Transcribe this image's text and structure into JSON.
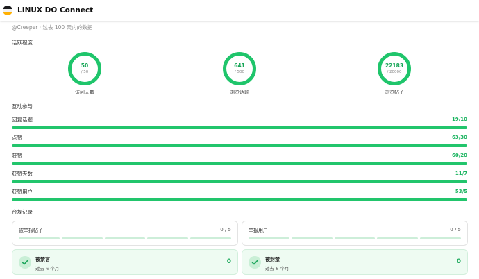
{
  "app": {
    "title": "LINUX DO Connect"
  },
  "subtitle": "@Creeper · 过去 100 天内的数据",
  "activity": {
    "label": "活跃程度",
    "rings": [
      {
        "value": "50",
        "target": "/ 50",
        "label": "访问天数",
        "progress": 1.0
      },
      {
        "value": "641",
        "target": "/ 500",
        "label": "浏览话题",
        "progress": 1.0
      },
      {
        "value": "22183",
        "target": "/ 20000",
        "label": "浏览帖子",
        "progress": 1.0
      }
    ]
  },
  "interaction": {
    "label": "互动参与",
    "rows": [
      {
        "label": "回复话题",
        "value": "19/10",
        "progress": 1.0
      },
      {
        "label": "点赞",
        "value": "63/30",
        "progress": 1.0
      },
      {
        "label": "获赞",
        "value": "60/20",
        "progress": 1.0
      },
      {
        "label": "获赞天数",
        "value": "11/7",
        "progress": 1.0
      },
      {
        "label": "获赞用户",
        "value": "53/5",
        "progress": 1.0
      }
    ]
  },
  "compliance": {
    "label": "合规记录",
    "reports": [
      {
        "title": "被举报帖子",
        "count": "0 / 5",
        "filled": 0,
        "segments": 5
      },
      {
        "title": "举报用户",
        "count": "0 / 5",
        "filled": 0,
        "segments": 5
      }
    ],
    "status": [
      {
        "title": "被禁言",
        "time": "过去 6 个月",
        "count": "0"
      },
      {
        "title": "被封禁",
        "time": "过去 6 个月",
        "count": "0"
      }
    ]
  },
  "colors": {
    "accent": "#22c56c",
    "track": "#d7f3e2",
    "ok_bg": "#eefbf2"
  }
}
